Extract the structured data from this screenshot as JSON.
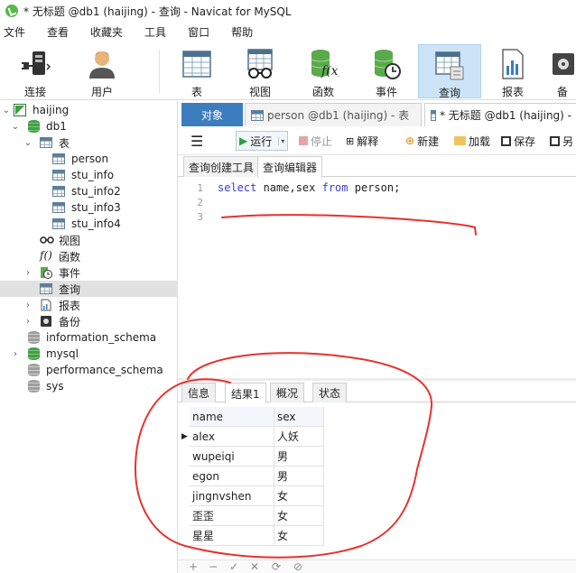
{
  "window": {
    "title": "* 无标题 @db1 (haijing) - 查询 - Navicat for MySQL"
  },
  "menu": [
    "文件",
    "查看",
    "收藏夹",
    "工具",
    "窗口",
    "帮助"
  ],
  "toolbar": {
    "connect": "连接",
    "user": "用户",
    "table": "表",
    "view": "视图",
    "function": "函数",
    "event": "事件",
    "query": "查询",
    "report": "报表",
    "backup": "备"
  },
  "navigator": {
    "connection": "haijing",
    "db1": "db1",
    "tables_group": "表",
    "tables": [
      "person",
      "stu_info",
      "stu_info2",
      "stu_info3",
      "stu_info4"
    ],
    "views": "视图",
    "functions": "函数",
    "events": "事件",
    "queries": "查询",
    "reports": "报表",
    "backups": "备份",
    "other_dbs": [
      "information_schema",
      "mysql",
      "performance_schema",
      "sys"
    ]
  },
  "tabs": {
    "objects": "对象",
    "tab1": "person @db1 (haijing) - 表",
    "tab2": "* 无标题 @db1 (haijing) -"
  },
  "query_toolbar": {
    "run": "运行",
    "stop": "停止",
    "explain": "解释",
    "new": "新建",
    "load": "加载",
    "save": "保存",
    "save_as": "另"
  },
  "subtabs": {
    "builder": "查询创建工具",
    "editor": "查询编辑器"
  },
  "editor": {
    "line_numbers": [
      "1",
      "2",
      "3"
    ],
    "kw_select": "select",
    "fields": " name,sex ",
    "kw_from": "from",
    "rest": " person;"
  },
  "result_tabs": [
    "信息",
    "结果1",
    "概况",
    "状态"
  ],
  "result": {
    "columns": [
      "name",
      "sex"
    ],
    "rows": [
      [
        "alex",
        "人妖"
      ],
      [
        "wupeiqi",
        "男"
      ],
      [
        "egon",
        "男"
      ],
      [
        "jingnvshen",
        "女"
      ],
      [
        "歪歪",
        "女"
      ],
      [
        "星星",
        "女"
      ]
    ]
  },
  "bottom_bar": [
    "+",
    "−",
    "✓",
    "✕",
    "⟳",
    "⊘"
  ],
  "colors": {
    "annotation": "#e8312c",
    "accent": "#3c7dbf",
    "keyword": "#3b3bd6"
  }
}
